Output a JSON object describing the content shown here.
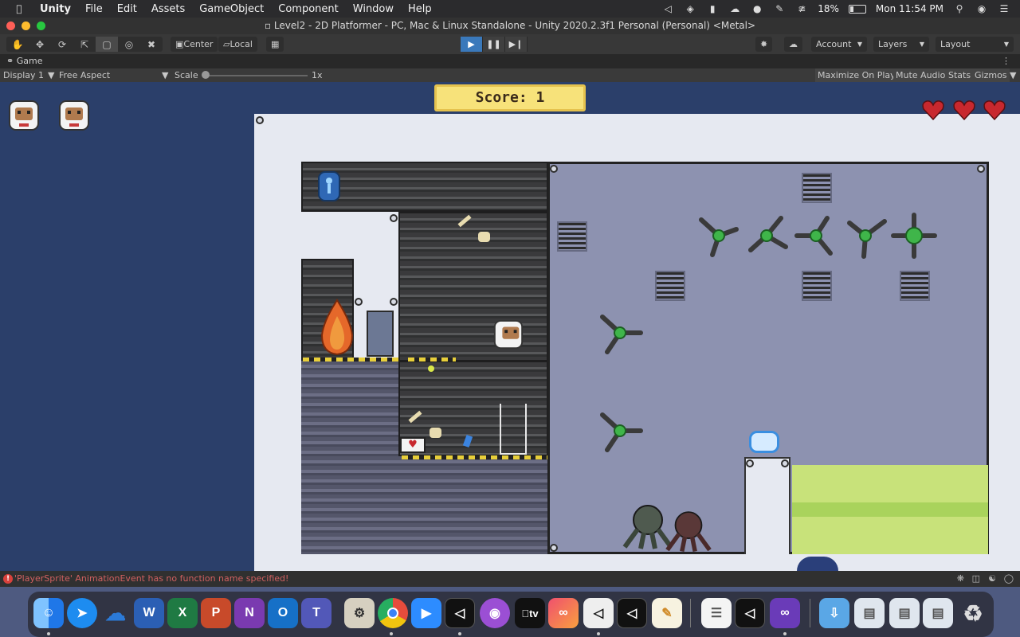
{
  "menubar": {
    "app_name": "Unity",
    "items": [
      "File",
      "Edit",
      "Assets",
      "GameObject",
      "Component",
      "Window",
      "Help"
    ],
    "battery": "18%",
    "clock": "Mon 11:54 PM"
  },
  "window": {
    "title": "Level2 - 2D Platformer - PC, Mac & Linux Standalone - Unity 2020.2.3f1 Personal (Personal) <Metal>"
  },
  "toolbar": {
    "pivot_label": "Center",
    "space_label": "Local",
    "account_label": "Account",
    "layers_label": "Layers",
    "layout_label": "Layout",
    "play_state": "playing"
  },
  "game_panel": {
    "tab_label": "Game",
    "display_label": "Display 1",
    "aspect_label": "Free Aspect",
    "scale_label": "Scale",
    "scale_value": "1x",
    "scale_fraction": 0.0,
    "maximize_label": "Maximize On Play",
    "mute_label": "Mute Audio",
    "stats_label": "Stats",
    "gizmos_label": "Gizmos"
  },
  "game": {
    "score_text": "Score:  1",
    "lives": 2,
    "hearts": 3
  },
  "console": {
    "message": "'PlayerSprite' AnimationEvent has no function name specified!"
  },
  "dock": {
    "apps": [
      "Finder",
      "Safari",
      "OneDrive",
      "Word",
      "Excel",
      "PowerPoint",
      "OneNote",
      "Outlook",
      "Teams",
      "Hub",
      "Chrome",
      "Zoom",
      "Unity",
      "Podcasts",
      "TV",
      "Creative Cloud",
      "Unity Hub",
      "Unity",
      "Script Editor",
      "TextEdit",
      "Unity",
      "Visual Studio",
      "Downloads",
      "Screenshot",
      "Screenshot",
      "Screenshot",
      "Trash"
    ],
    "letters": {
      "word": "W",
      "excel": "X",
      "powerpoint": "P",
      "onenote": "N",
      "outlook": "O",
      "teams": "T",
      "tv": "tv"
    }
  },
  "colors": {
    "unity_blue": "#3a79bb",
    "game_bg": "#2b3f6a",
    "error_red": "#d9413c",
    "score_yellow": "#f7e27a",
    "heart_red": "#c8282e"
  }
}
